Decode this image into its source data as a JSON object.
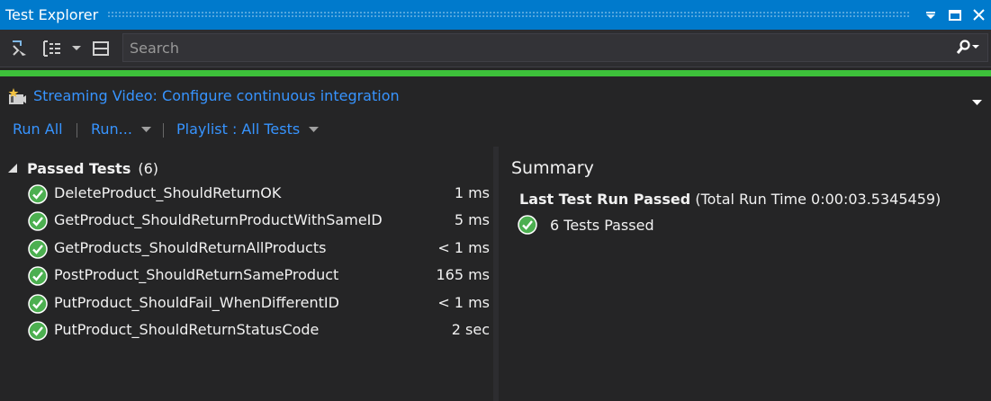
{
  "window": {
    "title": "Test Explorer"
  },
  "toolbar": {
    "search_placeholder": "Search"
  },
  "progress": {
    "fraction": 1.0,
    "color": "#3dc13a"
  },
  "group": {
    "link": "Streaming Video: Configure continuous integration"
  },
  "commands": {
    "run_all": "Run All",
    "run": "Run...",
    "playlist": "Playlist : All Tests"
  },
  "passed_group": {
    "title": "Passed Tests",
    "count": "(6)"
  },
  "tests": [
    {
      "name": "DeleteProduct_ShouldReturnOK",
      "duration": "1 ms"
    },
    {
      "name": "GetProduct_ShouldReturnProductWithSameID",
      "duration": "5 ms"
    },
    {
      "name": "GetProducts_ShouldReturnAllProducts",
      "duration": "< 1 ms"
    },
    {
      "name": "PostProduct_ShouldReturnSameProduct",
      "duration": "165 ms"
    },
    {
      "name": "PutProduct_ShouldFail_WhenDifferentID",
      "duration": "< 1 ms"
    },
    {
      "name": "PutProduct_ShouldReturnStatusCode",
      "duration": "2 sec"
    }
  ],
  "summary": {
    "title": "Summary",
    "last_run_label": "Last Test Run Passed",
    "last_run_detail": "(Total Run Time 0:00:03.5345459)",
    "passed_text": "6 Tests Passed"
  },
  "colors": {
    "accent": "#007acc",
    "link": "#3794ff",
    "pass": "#4caf50",
    "background": "#252526"
  }
}
